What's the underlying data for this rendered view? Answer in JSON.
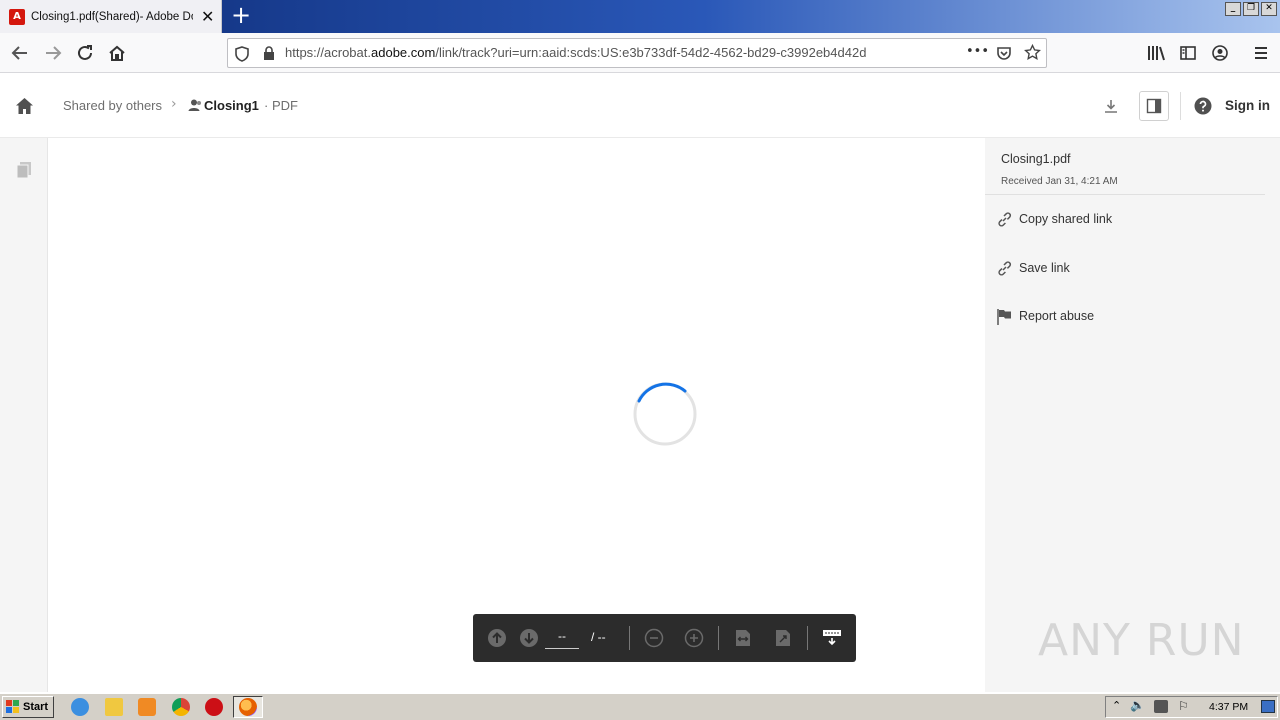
{
  "browser": {
    "tab_title": "Closing1.pdf(Shared)- Adobe Doc",
    "tab_close": "✕",
    "new_tab": "+",
    "url_prefix": "https://acrobat.",
    "url_domain": "adobe.com",
    "url_rest": "/link/track?uri=urn:aaid:scds:US:e3b733df-54d2-4562-bd29-c3992eb4d42d",
    "url_more": "•••",
    "window_controls": [
      "_",
      "❐",
      "✕"
    ]
  },
  "header": {
    "shared_by_others": "Shared by others",
    "breadcrumb_sep": "›",
    "file_name": "Closing1",
    "file_type": "· PDF",
    "sign_in": "Sign in"
  },
  "right_panel": {
    "file_name": "Closing1.pdf",
    "received": "Received Jan 31, 4:21 AM",
    "actions": [
      {
        "label": "Copy shared link",
        "icon": "link-icon"
      },
      {
        "label": "Save link",
        "icon": "link-icon"
      },
      {
        "label": "Report abuse",
        "icon": "flag-icon"
      }
    ]
  },
  "viewer_toolbar": {
    "page_current": "--",
    "page_total": "/ --"
  },
  "watermark": {
    "text": "ANY RUN"
  },
  "taskbar": {
    "start": "Start",
    "clock": "4:37 PM"
  },
  "colors": {
    "accent_blue": "#1473e6",
    "toolbar_bg": "#2c2c2c",
    "panel_bg": "#f5f5f5"
  }
}
